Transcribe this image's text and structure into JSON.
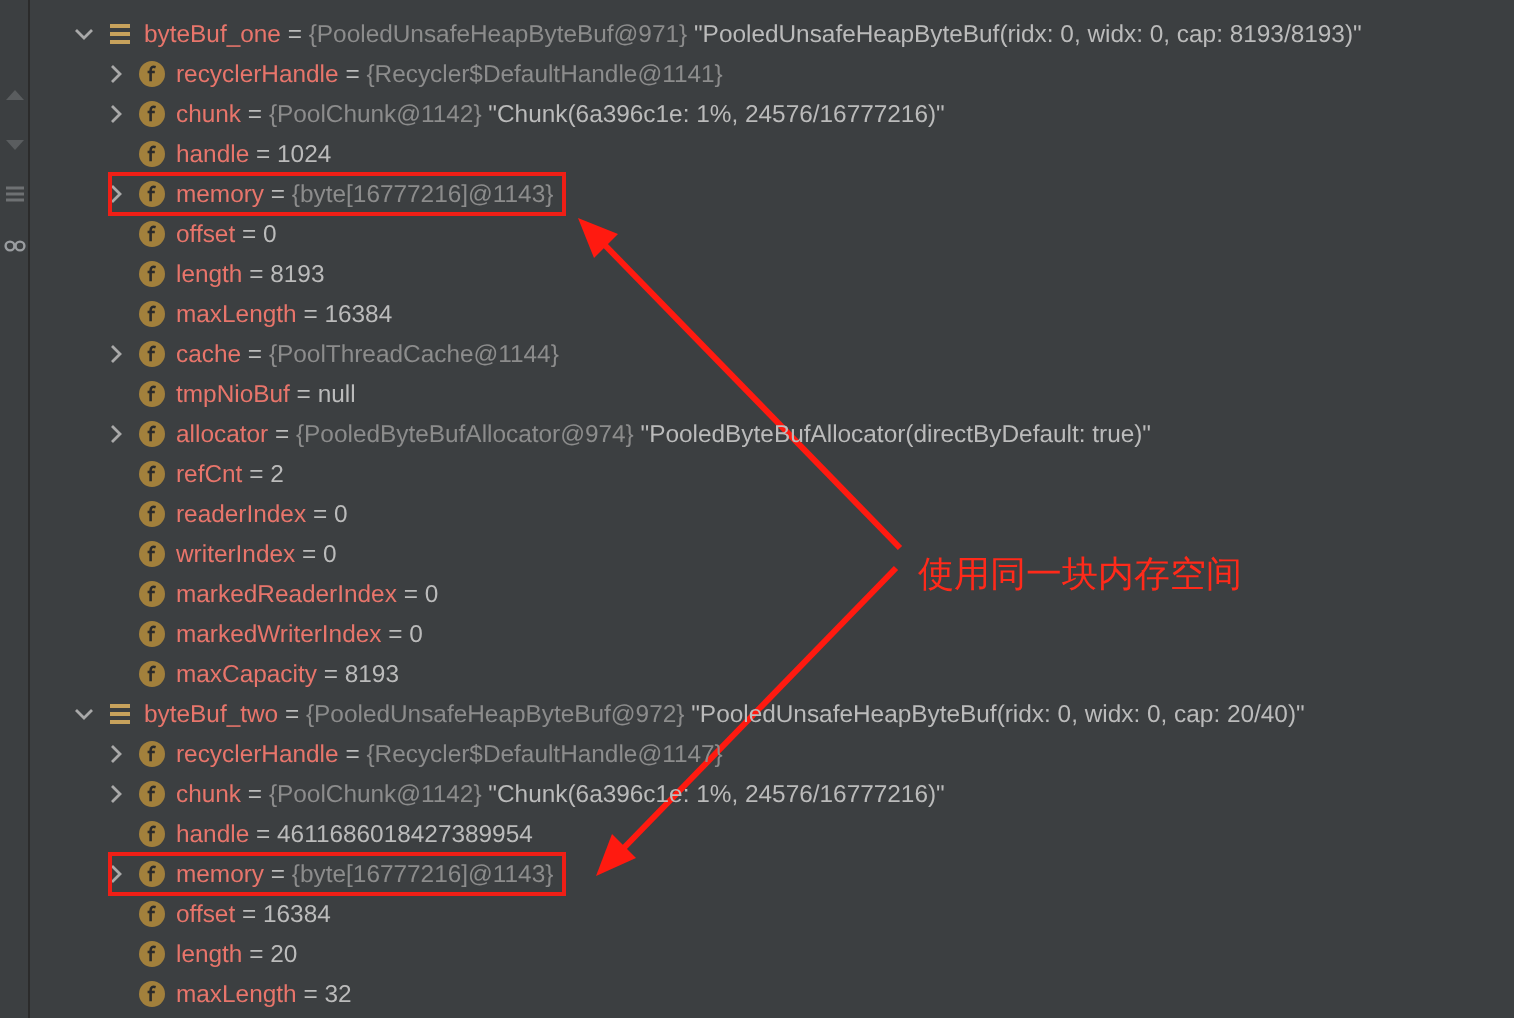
{
  "variables": [
    {
      "kind": "object",
      "name": "byteBuf_one",
      "operator": "=",
      "ref": "{PooledUnsafeHeapByteBuf@971}",
      "value": "\"PooledUnsafeHeapByteBuf(ridx: 0, widx: 0, cap: 8193/8193)\"",
      "expanded": true,
      "highlighted": false,
      "children": [
        {
          "kind": "field",
          "name": "recyclerHandle",
          "operator": "=",
          "ref": "{Recycler$DefaultHandle@1141}",
          "expanded": false,
          "highlighted": false
        },
        {
          "kind": "field",
          "name": "chunk",
          "operator": "=",
          "ref": "{PoolChunk@1142}",
          "value": "\"Chunk(6a396c1e: 1%, 24576/16777216)\"",
          "expanded": false,
          "highlighted": false
        },
        {
          "kind": "field",
          "name": "handle",
          "operator": "=",
          "value": "1024",
          "highlighted": false
        },
        {
          "kind": "field",
          "name": "memory",
          "operator": "=",
          "ref": "{byte[16777216]@1143}",
          "expanded": false,
          "highlighted": true
        },
        {
          "kind": "field",
          "name": "offset",
          "operator": "=",
          "value": "0",
          "highlighted": false
        },
        {
          "kind": "field",
          "name": "length",
          "operator": "=",
          "value": "8193",
          "highlighted": false
        },
        {
          "kind": "field",
          "name": "maxLength",
          "operator": "=",
          "value": "16384",
          "highlighted": false
        },
        {
          "kind": "field",
          "name": "cache",
          "operator": "=",
          "ref": "{PoolThreadCache@1144}",
          "expanded": false,
          "highlighted": false
        },
        {
          "kind": "field",
          "name": "tmpNioBuf",
          "operator": "=",
          "value": "null",
          "highlighted": false
        },
        {
          "kind": "field",
          "name": "allocator",
          "operator": "=",
          "ref": "{PooledByteBufAllocator@974}",
          "value": "\"PooledByteBufAllocator(directByDefault: true)\"",
          "expanded": false,
          "highlighted": false
        },
        {
          "kind": "field",
          "name": "refCnt",
          "operator": "=",
          "value": "2",
          "highlighted": false
        },
        {
          "kind": "field",
          "name": "readerIndex",
          "operator": "=",
          "value": "0",
          "highlighted": false
        },
        {
          "kind": "field",
          "name": "writerIndex",
          "operator": "=",
          "value": "0",
          "highlighted": false
        },
        {
          "kind": "field",
          "name": "markedReaderIndex",
          "operator": "=",
          "value": "0",
          "highlighted": false
        },
        {
          "kind": "field",
          "name": "markedWriterIndex",
          "operator": "=",
          "value": "0",
          "highlighted": false
        },
        {
          "kind": "field",
          "name": "maxCapacity",
          "operator": "=",
          "value": "8193",
          "highlighted": false
        }
      ]
    },
    {
      "kind": "object",
      "name": "byteBuf_two",
      "operator": "=",
      "ref": "{PooledUnsafeHeapByteBuf@972}",
      "value": "\"PooledUnsafeHeapByteBuf(ridx: 0, widx: 0, cap: 20/40)\"",
      "expanded": true,
      "highlighted": false,
      "children": [
        {
          "kind": "field",
          "name": "recyclerHandle",
          "operator": "=",
          "ref": "{Recycler$DefaultHandle@1147}",
          "expanded": false,
          "highlighted": false
        },
        {
          "kind": "field",
          "name": "chunk",
          "operator": "=",
          "ref": "{PoolChunk@1142}",
          "value": "\"Chunk(6a396c1e: 1%, 24576/16777216)\"",
          "expanded": false,
          "highlighted": false
        },
        {
          "kind": "field",
          "name": "handle",
          "operator": "=",
          "value": "4611686018427389954",
          "highlighted": false
        },
        {
          "kind": "field",
          "name": "memory",
          "operator": "=",
          "ref": "{byte[16777216]@1143}",
          "expanded": false,
          "highlighted": true
        },
        {
          "kind": "field",
          "name": "offset",
          "operator": "=",
          "value": "16384",
          "highlighted": false
        },
        {
          "kind": "field",
          "name": "length",
          "operator": "=",
          "value": "20",
          "highlighted": false
        },
        {
          "kind": "field",
          "name": "maxLength",
          "operator": "=",
          "value": "32",
          "highlighted": false
        }
      ]
    }
  ],
  "annotation": {
    "text": "使用同一块内存空间"
  }
}
